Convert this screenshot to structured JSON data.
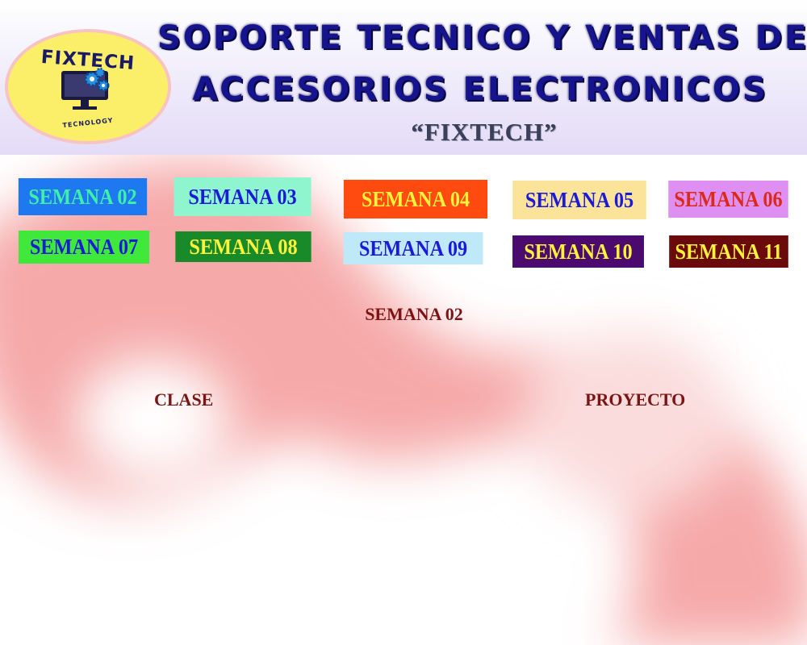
{
  "header": {
    "title_line1": "SOPORTE TECNICO Y VENTAS DE",
    "title_line2": "ACCESORIOS ELECTRONICOS",
    "subtitle": "“FIXTECH”"
  },
  "logo": {
    "brand": "FIXTECH",
    "tagline": "TECNOLOGY",
    "icon": "computer-gears-icon"
  },
  "weeks": [
    {
      "label": "SEMANA 02",
      "bg": "#1e78f0",
      "fg": "#3ef0a8"
    },
    {
      "label": "SEMANA 03",
      "bg": "#8ff5cf",
      "fg": "#1a1ad8"
    },
    {
      "label": "SEMANA 04",
      "bg": "#ff4a10",
      "fg": "#fff23a"
    },
    {
      "label": "SEMANA 05",
      "bg": "#fbe49a",
      "fg": "#1a1ad8"
    },
    {
      "label": "SEMANA 06",
      "bg": "#df8ff2",
      "fg": "#d92a1a"
    },
    {
      "label": "SEMANA 07",
      "bg": "#3fe83a",
      "fg": "#1a1ad8"
    },
    {
      "label": "SEMANA 08",
      "bg": "#198a2a",
      "fg": "#fff23a"
    },
    {
      "label": "SEMANA 09",
      "bg": "#bfe9f8",
      "fg": "#1a1ad8"
    },
    {
      "label": "SEMANA 10",
      "bg": "#4a0a6e",
      "fg": "#fff23a"
    },
    {
      "label": "SEMANA 11",
      "bg": "#6a0a0a",
      "fg": "#fff23a"
    }
  ],
  "content": {
    "current_week": "SEMANA 02",
    "clase": "CLASE",
    "proyecto": "PROYECTO"
  }
}
